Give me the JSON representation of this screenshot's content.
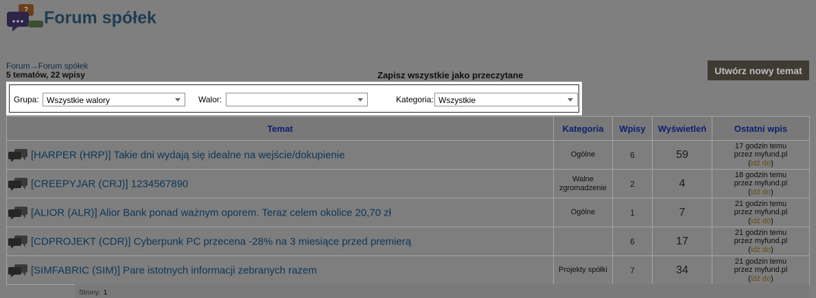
{
  "header": {
    "title": "Forum spółek",
    "logo_icon": "chat-bubbles-question-icon"
  },
  "breadcrumb": {
    "root": "Forum",
    "separator": "→",
    "current": "Forum spółek"
  },
  "stats": "5 tematów, 22 wpisy",
  "mark_all_read": "Zapisz wszystkie jako przeczytane",
  "new_topic_button": "Utwórz nowy temat",
  "filters": {
    "group": {
      "label": "Grupa:",
      "value": "Wszystkie walory"
    },
    "asset": {
      "label": "Walor:",
      "value": ""
    },
    "category": {
      "label": "Kategoria:",
      "value": "Wszystkie"
    }
  },
  "table": {
    "columns": {
      "topic": "Temat",
      "category": "Kategoria",
      "posts": "Wpisy",
      "views": "Wyświetleń",
      "last_post": "Ostatni wpis"
    },
    "goto_label": "idź do",
    "rows": [
      {
        "title": "[HARPER (HRP)] Takie dni wydają się idealne na wejście/dokupienie",
        "category": "Ogólne",
        "posts": "6",
        "views": "59",
        "last_time": "17 godzin temu",
        "last_by": "przez myfund.pl"
      },
      {
        "title": "[CREEPYJAR (CRJ)] 1234567890",
        "category": "Walne zgromadzenie",
        "posts": "2",
        "views": "4",
        "last_time": "18 godzin temu",
        "last_by": "przez myfund.pl"
      },
      {
        "title": "[ALIOR (ALR)] Alior Bank ponad ważnym oporem. Teraz celem okolice 20,70 zł",
        "category": "Ogólne",
        "posts": "1",
        "views": "7",
        "last_time": "21 godzin temu",
        "last_by": "przez myfund.pl"
      },
      {
        "title": "[CDPROJEKT (CDR)] Cyberpunk PC przecena -28% na 3 miesiące przed premierą",
        "category": "",
        "posts": "6",
        "views": "17",
        "last_time": "21 godzin temu",
        "last_by": "przez myfund.pl"
      },
      {
        "title": "[SIMFABRIC (SIM)] Pare istotnych informacji zebranych razem",
        "category": "Projekty spółki",
        "posts": "7",
        "views": "34",
        "last_time": "21 godzin temu",
        "last_by": "przez myfund.pl"
      }
    ]
  },
  "pagination": {
    "label": "Strony:",
    "current": "1"
  }
}
